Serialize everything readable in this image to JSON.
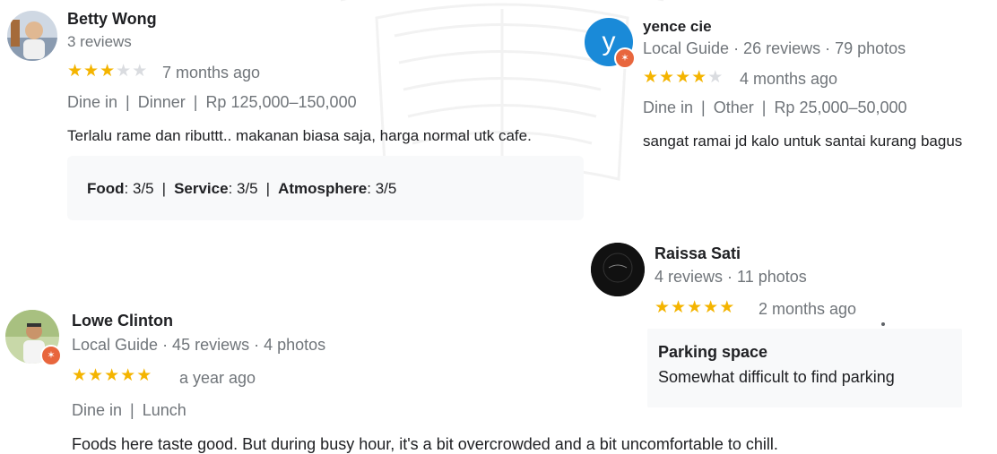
{
  "reviews": [
    {
      "name": "Betty Wong",
      "meta": "3 reviews",
      "rating": 3,
      "when": "7 months ago",
      "details": [
        "Dine in",
        "Dinner",
        "Rp 125,000–150,000"
      ],
      "text": "Terlalu rame dan ributtt.. makanan biasa saja, harga normal utk cafe.",
      "ratings": [
        {
          "label": "Food",
          "value": ": 3/5"
        },
        {
          "label": "Service",
          "value": ": 3/5"
        },
        {
          "label": "Atmosphere",
          "value": ": 3/5"
        }
      ]
    },
    {
      "name": "yence cie",
      "avatar_letter": "y",
      "meta": "Local Guide · 26 reviews · 79 photos",
      "rating": 4,
      "when": "4 months ago",
      "details": [
        "Dine in",
        "Other",
        "Rp 25,000–50,000"
      ],
      "text": "sangat ramai jd kalo untuk santai kurang bagus"
    },
    {
      "name": "Raissa Sati",
      "meta": "4 reviews · 11 photos",
      "rating": 5,
      "when": "2 months ago",
      "box_title": "Parking space",
      "box_text": "Somewhat difficult to find parking"
    },
    {
      "name": "Lowe Clinton",
      "meta": "Local Guide · 45 reviews · 4 photos",
      "rating": 5,
      "when": "a year ago",
      "details": [
        "Dine in",
        "Lunch"
      ],
      "text": "Foods here taste good. But during busy hour, it's a bit overcrowded and a bit uncomfortable to chill."
    }
  ],
  "icons": {
    "star": "★",
    "guide_badge": "✶"
  },
  "colors": {
    "star_on": "#f4b400",
    "star_off": "#dadce0",
    "guide_badge": "#e8663d",
    "avatar_letter_bg": "#1a8ad8"
  }
}
